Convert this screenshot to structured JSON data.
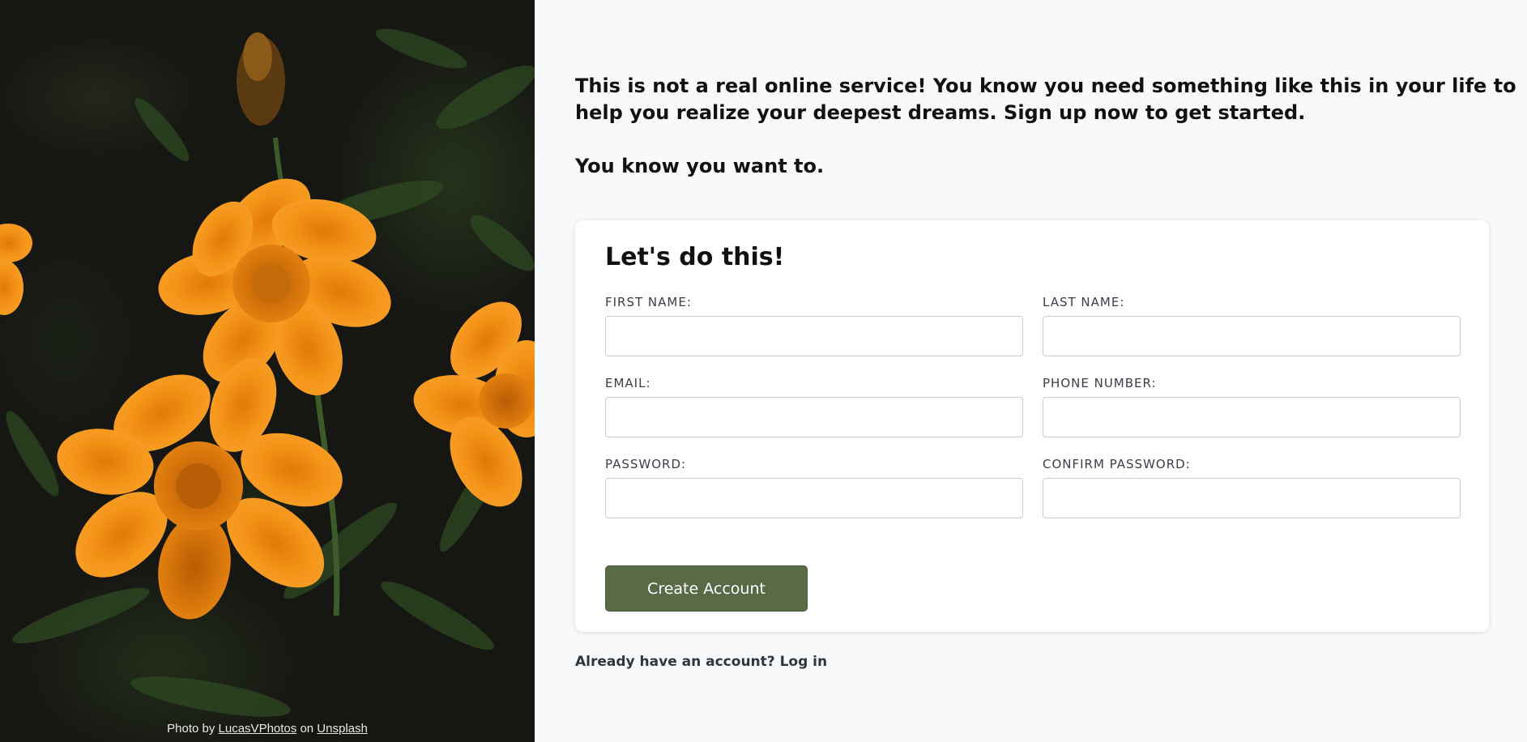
{
  "photo": {
    "credit_prefix": "Photo by",
    "author_link": "LucasVPhotos",
    "credit_middle": "on",
    "source_link": "Unsplash"
  },
  "intro": {
    "paragraph_1": "This is not a real online service! You know you need something like this in your life to help you realize your deepest dreams. Sign up now to get started.",
    "paragraph_2": "You know you want to."
  },
  "form": {
    "heading": "Let's do this!",
    "fields": {
      "first_name": {
        "label": "FIRST NAME:",
        "value": "",
        "placeholder": ""
      },
      "last_name": {
        "label": "LAST NAME:",
        "value": "",
        "placeholder": ""
      },
      "email": {
        "label": "EMAIL:",
        "value": "",
        "placeholder": ""
      },
      "phone": {
        "label": "PHONE NUMBER:",
        "value": "",
        "placeholder": ""
      },
      "password": {
        "label": "PASSWORD:",
        "value": "",
        "placeholder": ""
      },
      "confirm_password": {
        "label": "CONFIRM PASSWORD:",
        "value": "",
        "placeholder": ""
      }
    },
    "submit_label": "Create Account"
  },
  "login": {
    "prompt": "Already have an account?",
    "link": "Log in"
  },
  "colors": {
    "button": "#596a46",
    "flower": "#f28c0f",
    "page_background": "#f8f9fa"
  }
}
